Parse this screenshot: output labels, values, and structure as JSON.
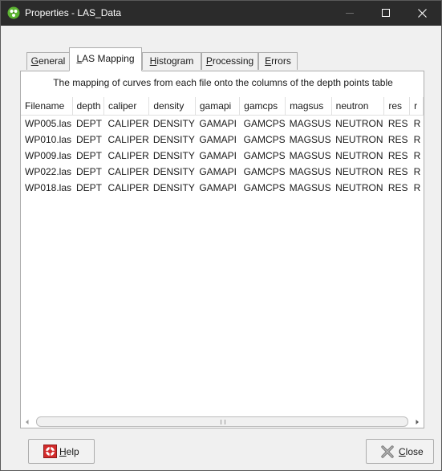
{
  "window": {
    "title": "Properties - LAS_Data"
  },
  "tabs": [
    {
      "accel": "G",
      "rest": "eneral"
    },
    {
      "accel": "L",
      "rest": "AS Mapping"
    },
    {
      "accel": "H",
      "rest": "istogram"
    },
    {
      "accel": "P",
      "rest": "rocessing"
    },
    {
      "accel": "E",
      "rest": "rrors"
    }
  ],
  "active_tab": "LAS Mapping",
  "description": "The mapping of curves from each file onto the columns of the depth points table",
  "table": {
    "columns": [
      "Filename",
      "depth",
      "caliper",
      "density",
      "gamapi",
      "gamcps",
      "magsus",
      "neutron",
      "res",
      "r"
    ],
    "rows": [
      [
        "WP005.las",
        "DEPT",
        "CALIPER",
        "DENSITY",
        "GAMAPI",
        "GAMCPS",
        "MAGSUS",
        "NEUTRON",
        "RES",
        "R"
      ],
      [
        "WP010.las",
        "DEPT",
        "CALIPER",
        "DENSITY",
        "GAMAPI",
        "GAMCPS",
        "MAGSUS",
        "NEUTRON",
        "RES",
        "R"
      ],
      [
        "WP009.las",
        "DEPT",
        "CALIPER",
        "DENSITY",
        "GAMAPI",
        "GAMCPS",
        "MAGSUS",
        "NEUTRON",
        "RES",
        "R"
      ],
      [
        "WP022.las",
        "DEPT",
        "CALIPER",
        "DENSITY",
        "GAMAPI",
        "GAMCPS",
        "MAGSUS",
        "NEUTRON",
        "RES",
        "R"
      ],
      [
        "WP018.las",
        "DEPT",
        "CALIPER",
        "DENSITY",
        "GAMAPI",
        "GAMCPS",
        "MAGSUS",
        "NEUTRON",
        "RES",
        "R"
      ]
    ]
  },
  "buttons": {
    "help": {
      "accel": "H",
      "rest": "elp",
      "icon": "lifebuoy-icon"
    },
    "close": {
      "accel": "C",
      "rest": "lose",
      "icon": "x-close-icon"
    }
  },
  "colors": {
    "titlebar": "#2b2b2b",
    "app_icon": "#5cb531",
    "help_icon": "#d32b2b"
  }
}
